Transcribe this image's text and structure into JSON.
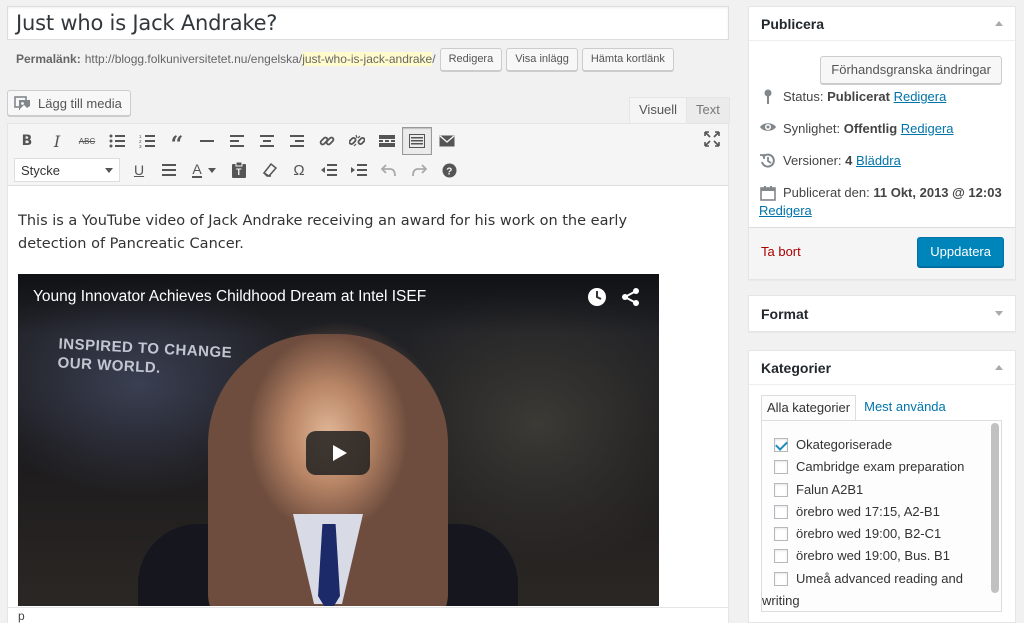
{
  "post": {
    "title": "Just who is Jack Andrake?",
    "permalink_label": "Permalänk:",
    "permalink_base": "http://blogg.folkuniversitetet.nu/engelska/",
    "permalink_slug": "just-who-is-jack-andrake",
    "permalink_trail": "/",
    "edit_btn": "Redigera",
    "view_btn": "Visa inlägg",
    "shortlink_btn": "Hämta kortlänk"
  },
  "editor": {
    "add_media": "Lägg till media",
    "tab_visual": "Visuell",
    "tab_text": "Text",
    "format_value": "Stycke",
    "body_text": "This is a YouTube video of Jack Andrake receiving an award for his work on the early detection of Pancreatic Cancer.",
    "video_title": "Young Innovator Achieves Childhood Dream at Intel ISEF",
    "video_banner": "INSPIRED TO CHANGE\nOUR WORLD.",
    "path": "p"
  },
  "publish": {
    "title": "Publicera",
    "preview_btn": "Förhandsgranska ändringar",
    "status_label": "Status:",
    "status_value": "Publicerat",
    "visibility_label": "Synlighet:",
    "visibility_value": "Offentlig",
    "revisions_label": "Versioner:",
    "revisions_value": "4",
    "browse_link": "Bläddra",
    "published_label": "Publicerat den:",
    "published_value": "11 Okt, 2013 @ 12:03",
    "edit_link": "Redigera",
    "delete_link": "Ta bort",
    "update_btn": "Uppdatera"
  },
  "format_box": {
    "title": "Format"
  },
  "categories": {
    "title": "Kategorier",
    "tab_all": "Alla kategorier",
    "tab_most_used": "Mest använda",
    "items": [
      {
        "label": "Okategoriserade",
        "checked": true
      },
      {
        "label": "Cambridge exam preparation",
        "checked": false
      },
      {
        "label": "Falun A2B1",
        "checked": false
      },
      {
        "label": "örebro wed 17:15, A2-B1",
        "checked": false
      },
      {
        "label": "örebro wed 19:00, B2-C1",
        "checked": false
      },
      {
        "label": "örebro wed 19:00, Bus. B1",
        "checked": false
      },
      {
        "label": "Umeå advanced reading and",
        "checked": false
      },
      {
        "label": "writing",
        "checked": false
      }
    ]
  },
  "colors": {
    "link": "#0073aa",
    "primary_button": "#0085ba",
    "delete": "#aa0000",
    "slug_highlight": "#fffbcc"
  }
}
